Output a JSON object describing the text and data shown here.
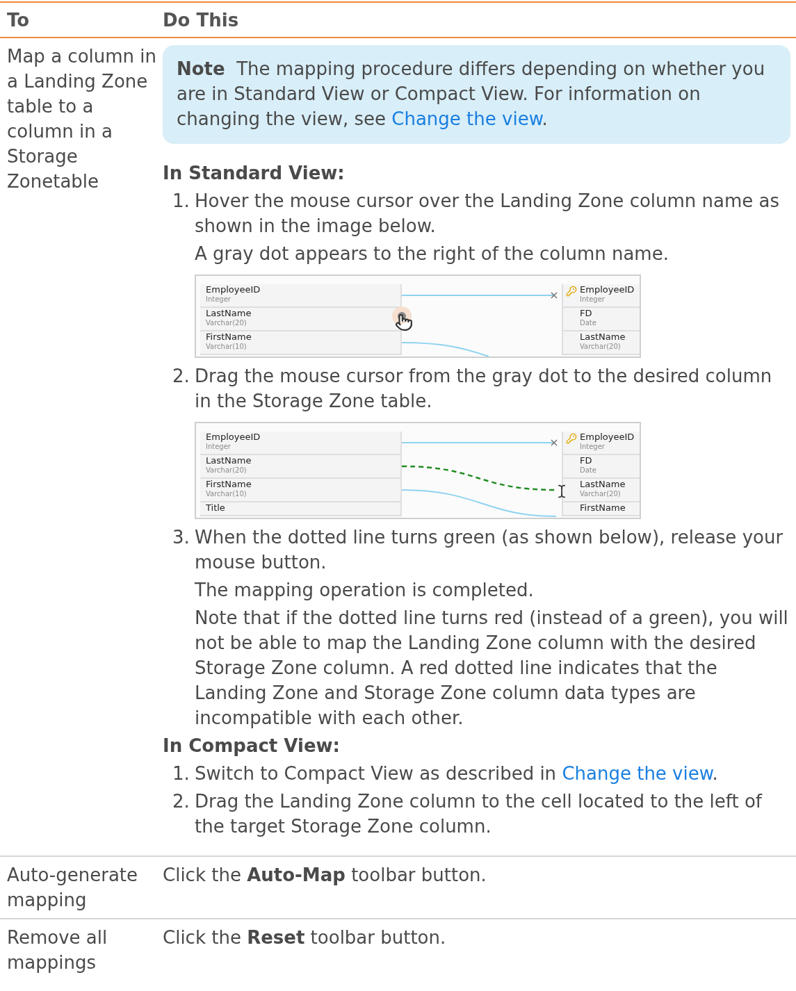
{
  "table": {
    "columns": [
      "To",
      "Do This"
    ],
    "rows": [
      {
        "kind": "procedure",
        "to": "Map a column in a Landing Zone table to a column in a Storage Zonetable",
        "note": {
          "segments": [
            {
              "text": "**Note**  The mapping procedure differs depending on whether you are in Standard View or Compact View. For information on changing the view, see ",
              "link": false
            },
            {
              "text": "Change the view",
              "link": true
            },
            {
              "text": ".",
              "link": false
            }
          ]
        },
        "sections": [
          {
            "heading": "In Standard View:",
            "steps": [
              {
                "number": "1.",
                "segments": [
                  {
                    "text": "Hover the mouse cursor over the Landing Zone column name as shown in the image below.",
                    "link": false
                  }
                ],
                "paragraphs": [
                  "A gray dot appears to the right of the column name."
                ],
                "figure": {
                  "kind": "hover",
                  "left": [
                    {
                      "name": "EmployeeID",
                      "type": "Integer"
                    },
                    {
                      "name": "LastName",
                      "type": "Varchar(20)"
                    },
                    {
                      "name": "FirstName",
                      "type": "Varchar(10)"
                    }
                  ],
                  "right": [
                    {
                      "name": "EmployeeID",
                      "type": "Integer",
                      "key": true
                    },
                    {
                      "name": "FD",
                      "type": "Date",
                      "key": false
                    },
                    {
                      "name": "LastName",
                      "type": "Varchar(20)",
                      "key": false
                    }
                  ]
                }
              },
              {
                "number": "2.",
                "segments": [
                  {
                    "text": "Drag the mouse cursor from the gray dot to the desired column in the Storage Zone table.",
                    "link": false
                  }
                ],
                "figure": {
                  "kind": "drag",
                  "left": [
                    {
                      "name": "EmployeeID",
                      "type": "Integer"
                    },
                    {
                      "name": "LastName",
                      "type": "Varchar(20)"
                    },
                    {
                      "name": "FirstName",
                      "type": "Varchar(10)"
                    },
                    {
                      "name": "Title"
                    }
                  ],
                  "right": [
                    {
                      "name": "EmployeeID",
                      "type": "Integer",
                      "key": true
                    },
                    {
                      "name": "FD",
                      "type": "Date",
                      "key": false
                    },
                    {
                      "name": "LastName",
                      "type": "Varchar(20)",
                      "key": false
                    },
                    {
                      "name": "FirstName",
                      "key": false
                    }
                  ]
                }
              },
              {
                "number": "3.",
                "segments": [
                  {
                    "text": "When the dotted line turns green (as shown below), release your mouse button.",
                    "link": false
                  }
                ],
                "paragraphs": [
                  "The mapping operation is completed.",
                  "Note that if the dotted line turns red (instead of a green), you will not be able to map the Landing Zone column with the desired Storage Zone column. A red dotted line indicates that the Landing Zone and Storage Zone column data types are incompatible with each other."
                ]
              }
            ]
          },
          {
            "heading": "In Compact View:",
            "steps": [
              {
                "number": "1.",
                "segments": [
                  {
                    "text": "Switch to Compact View as described in ",
                    "link": false
                  },
                  {
                    "text": "Change the view",
                    "link": true
                  },
                  {
                    "text": ".",
                    "link": false
                  }
                ]
              },
              {
                "number": "2.",
                "segments": [
                  {
                    "text": "Drag the Landing Zone column to the cell located to the left of the target Storage Zone column.",
                    "link": false
                  }
                ]
              }
            ]
          }
        ]
      },
      {
        "kind": "simple",
        "to": "Auto-generate mapping",
        "text": "Click the **Auto-Map** toolbar button."
      },
      {
        "kind": "simple",
        "to": "Remove all mappings",
        "text": "Click the **Reset** toolbar button."
      }
    ]
  }
}
